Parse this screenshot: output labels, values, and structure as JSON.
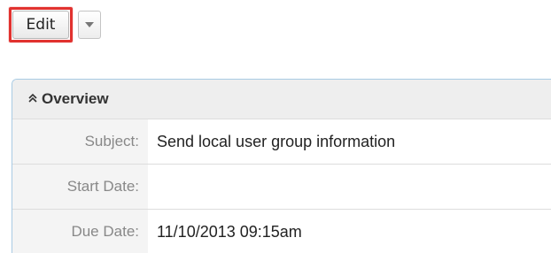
{
  "toolbar": {
    "edit_label": "Edit",
    "dropdown_icon": "caret-down-icon"
  },
  "panel": {
    "toggle_icon": "double-chevron-up-icon",
    "title": "Overview",
    "fields": [
      {
        "label": "Subject:",
        "value": "Send local user group information"
      },
      {
        "label": "Start Date:",
        "value": ""
      },
      {
        "label": "Due Date:",
        "value": "11/10/2013 09:15am"
      }
    ]
  },
  "colors": {
    "highlight": "#e1322f",
    "panel_border": "#a9cbe4",
    "header_bg": "#eeeeee",
    "label_text": "#888888"
  }
}
